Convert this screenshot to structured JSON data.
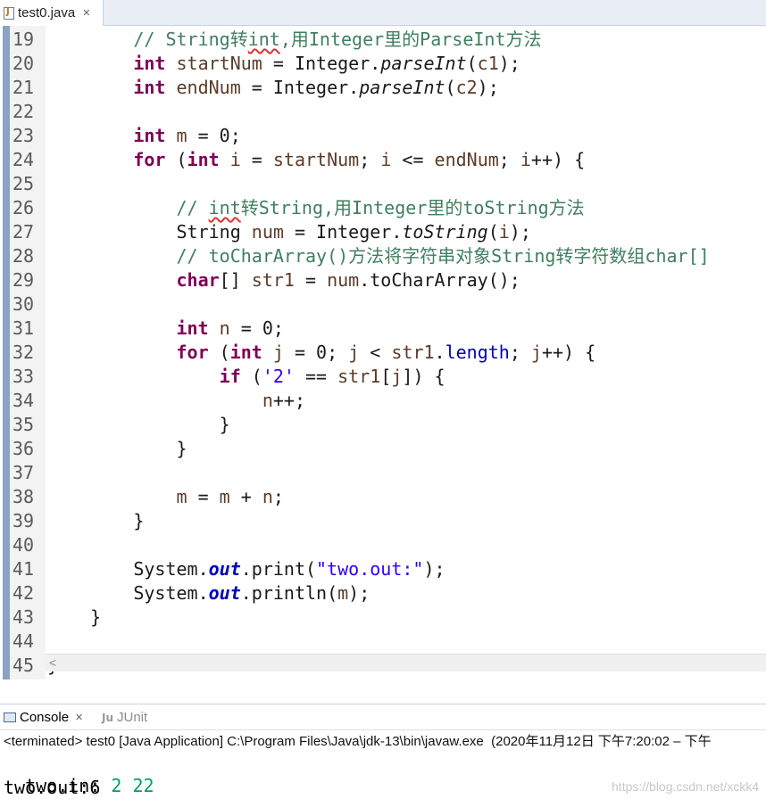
{
  "editor_tab": {
    "filename": "test0.java",
    "close": "✕"
  },
  "code_lines": [
    {
      "n": "19",
      "html": "        <span class='cm'>// String转<span class='squig'>int</span>,用Integer里的ParseInt方法</span>"
    },
    {
      "n": "20",
      "html": "        <span class='kw'>int</span> <span class='var'>startNum</span> = Integer.<span class='ital'>parseInt</span>(<span class='var'>c1</span>);"
    },
    {
      "n": "21",
      "html": "        <span class='kw'>int</span> <span class='var'>endNum</span> = Integer.<span class='ital'>parseInt</span>(<span class='var'>c2</span>);"
    },
    {
      "n": "22",
      "html": ""
    },
    {
      "n": "23",
      "html": "        <span class='kw'>int</span> <span class='var'>m</span> = 0;"
    },
    {
      "n": "24",
      "html": "        <span class='kw'>for</span> (<span class='kw'>int</span> <span class='var'>i</span> = <span class='var'>startNum</span>; <span class='var'>i</span> &lt;= <span class='var'>endNum</span>; <span class='var'>i</span>++) {"
    },
    {
      "n": "25",
      "html": ""
    },
    {
      "n": "26",
      "html": "            <span class='cm'>// <span class='squig'>int</span>转String,用Integer里的toString方法</span>"
    },
    {
      "n": "27",
      "html": "            String <span class='var'>num</span> = Integer.<span class='ital'>toString</span>(<span class='var'>i</span>);"
    },
    {
      "n": "28",
      "html": "            <span class='cm'>// toCharArray()方法将字符串对象String转字符数组char[]</span>"
    },
    {
      "n": "29",
      "html": "            <span class='kw'>char</span>[] <span class='var'>str1</span> = <span class='var'>num</span>.toCharArray();"
    },
    {
      "n": "30",
      "html": ""
    },
    {
      "n": "31",
      "html": "            <span class='kw'>int</span> <span class='var'>n</span> = 0;"
    },
    {
      "n": "32",
      "html": "            <span class='kw'>for</span> (<span class='kw'>int</span> <span class='var'>j</span> = 0; <span class='var'>j</span> &lt; <span class='var'>str1</span>.<span class='fld'>length</span>; <span class='var'>j</span>++) {"
    },
    {
      "n": "33",
      "html": "                <span class='kw'>if</span> (<span class='str'>'2'</span> == <span class='var'>str1</span>[<span class='var'>j</span>]) {"
    },
    {
      "n": "34",
      "html": "                    <span class='var'>n</span>++;"
    },
    {
      "n": "35",
      "html": "                }"
    },
    {
      "n": "36",
      "html": "            }"
    },
    {
      "n": "37",
      "html": ""
    },
    {
      "n": "38",
      "html": "            <span class='var'>m</span> = <span class='var'>m</span> + <span class='var'>n</span>;"
    },
    {
      "n": "39",
      "html": "        }"
    },
    {
      "n": "40",
      "html": ""
    },
    {
      "n": "41",
      "html": "        System.<span class='stat'>out</span>.print(<span class='str'>\"two.out:\"</span>);"
    },
    {
      "n": "42",
      "html": "        System.<span class='stat'>out</span>.println(<span class='var'>m</span>);"
    },
    {
      "n": "43",
      "html": "    }"
    },
    {
      "n": "44",
      "html": ""
    },
    {
      "n": "45",
      "html": "}"
    }
  ],
  "scroll_arrow": "<",
  "console_tabs": {
    "console": "Console",
    "console_close": "✕",
    "junit_icon": "Ju",
    "junit": "JUnit"
  },
  "status": "<terminated> test0 [Java Application] C:\\Program Files\\Java\\jdk-13\\bin\\javaw.exe  (2020年11月12日 下午7:20:02 – 下午",
  "output": {
    "line1_prefix": "two.in: ",
    "line1_input": "2 22",
    "line2": "two.out:6"
  },
  "watermark": "https://blog.csdn.net/xckk4"
}
